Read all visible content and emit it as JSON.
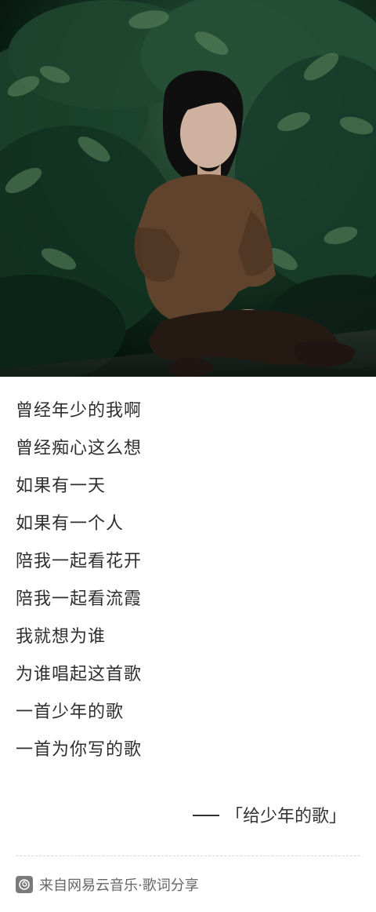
{
  "photo": {
    "icon": "woman-sitting-in-foliage-photo"
  },
  "lyrics": {
    "lines": [
      "曾经年少的我啊",
      "曾经痴心这么想",
      "如果有一天",
      "如果有一个人",
      "陪我一起看花开",
      "陪我一起看流霞",
      "我就想为谁",
      "为谁唱起这首歌",
      "一首少年的歌",
      "一首为你写的歌"
    ]
  },
  "attribution": {
    "song": "「给少年的歌」"
  },
  "footer": {
    "icon": "netease-music-icon",
    "text": "来自网易云音乐·歌词分享"
  }
}
